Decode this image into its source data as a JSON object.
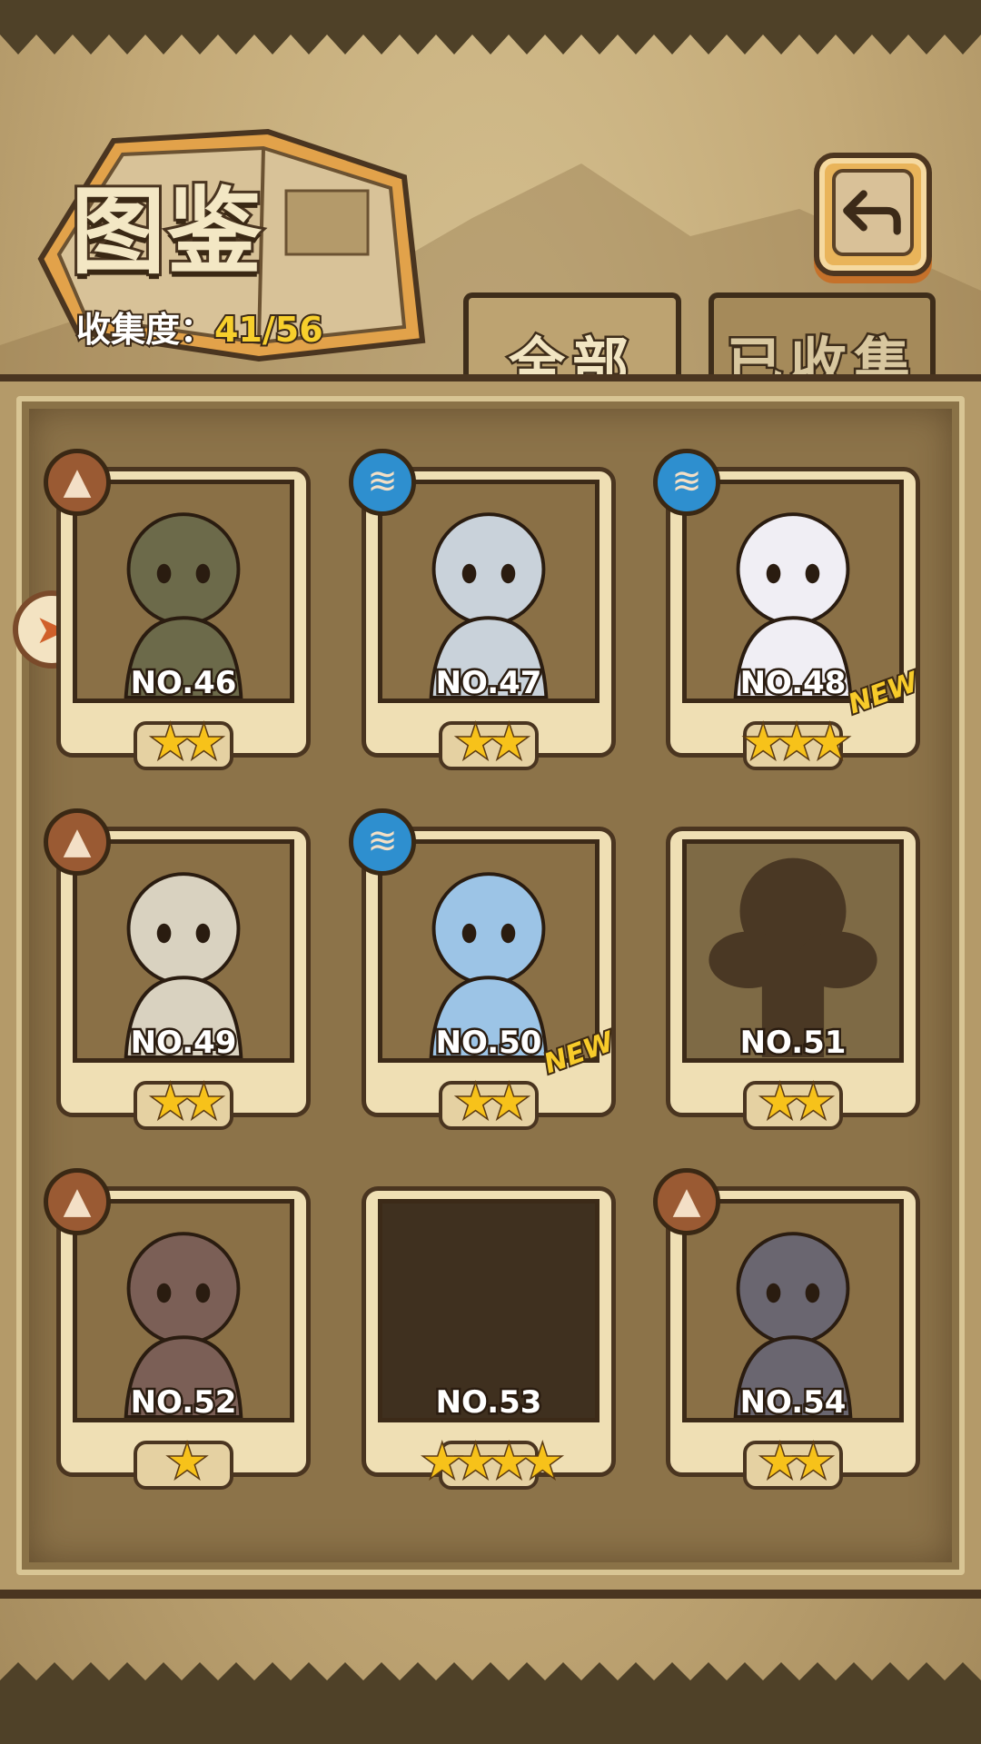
{
  "header": {
    "title": "图鉴",
    "collection_label": "收集度：",
    "collection_value": "41/56"
  },
  "tabs": [
    {
      "label": "全部",
      "active": true
    },
    {
      "label": "已收集",
      "active": false
    }
  ],
  "icons": {
    "back": "back-arrow-icon",
    "earth": "mountain-element-icon",
    "water": "water-wave-element-icon",
    "side": "side-arrow-icon"
  },
  "cards": [
    {
      "no": "NO.46",
      "stars": "★★",
      "element": "earth",
      "new": false,
      "state": "collected"
    },
    {
      "no": "NO.47",
      "stars": "★★",
      "element": "water",
      "new": false,
      "state": "collected"
    },
    {
      "no": "NO.48",
      "stars": "★★★",
      "element": "water",
      "new": true,
      "state": "collected"
    },
    {
      "no": "NO.49",
      "stars": "★★",
      "element": "earth",
      "new": false,
      "state": "collected"
    },
    {
      "no": "NO.50",
      "stars": "★★",
      "element": "water",
      "new": true,
      "state": "collected"
    },
    {
      "no": "NO.51",
      "stars": "★★",
      "element": "",
      "new": false,
      "state": "silhouette"
    },
    {
      "no": "NO.52",
      "stars": "★",
      "element": "earth",
      "new": false,
      "state": "collected"
    },
    {
      "no": "NO.53",
      "stars": "★★★★",
      "element": "",
      "new": false,
      "state": "empty"
    },
    {
      "no": "NO.54",
      "stars": "★★",
      "element": "earth",
      "new": false,
      "state": "collected"
    }
  ],
  "new_label": "NEW",
  "colors": {
    "gold": "#f7cf2c",
    "earth": "#9a5a33",
    "water": "#2e8fcf"
  }
}
